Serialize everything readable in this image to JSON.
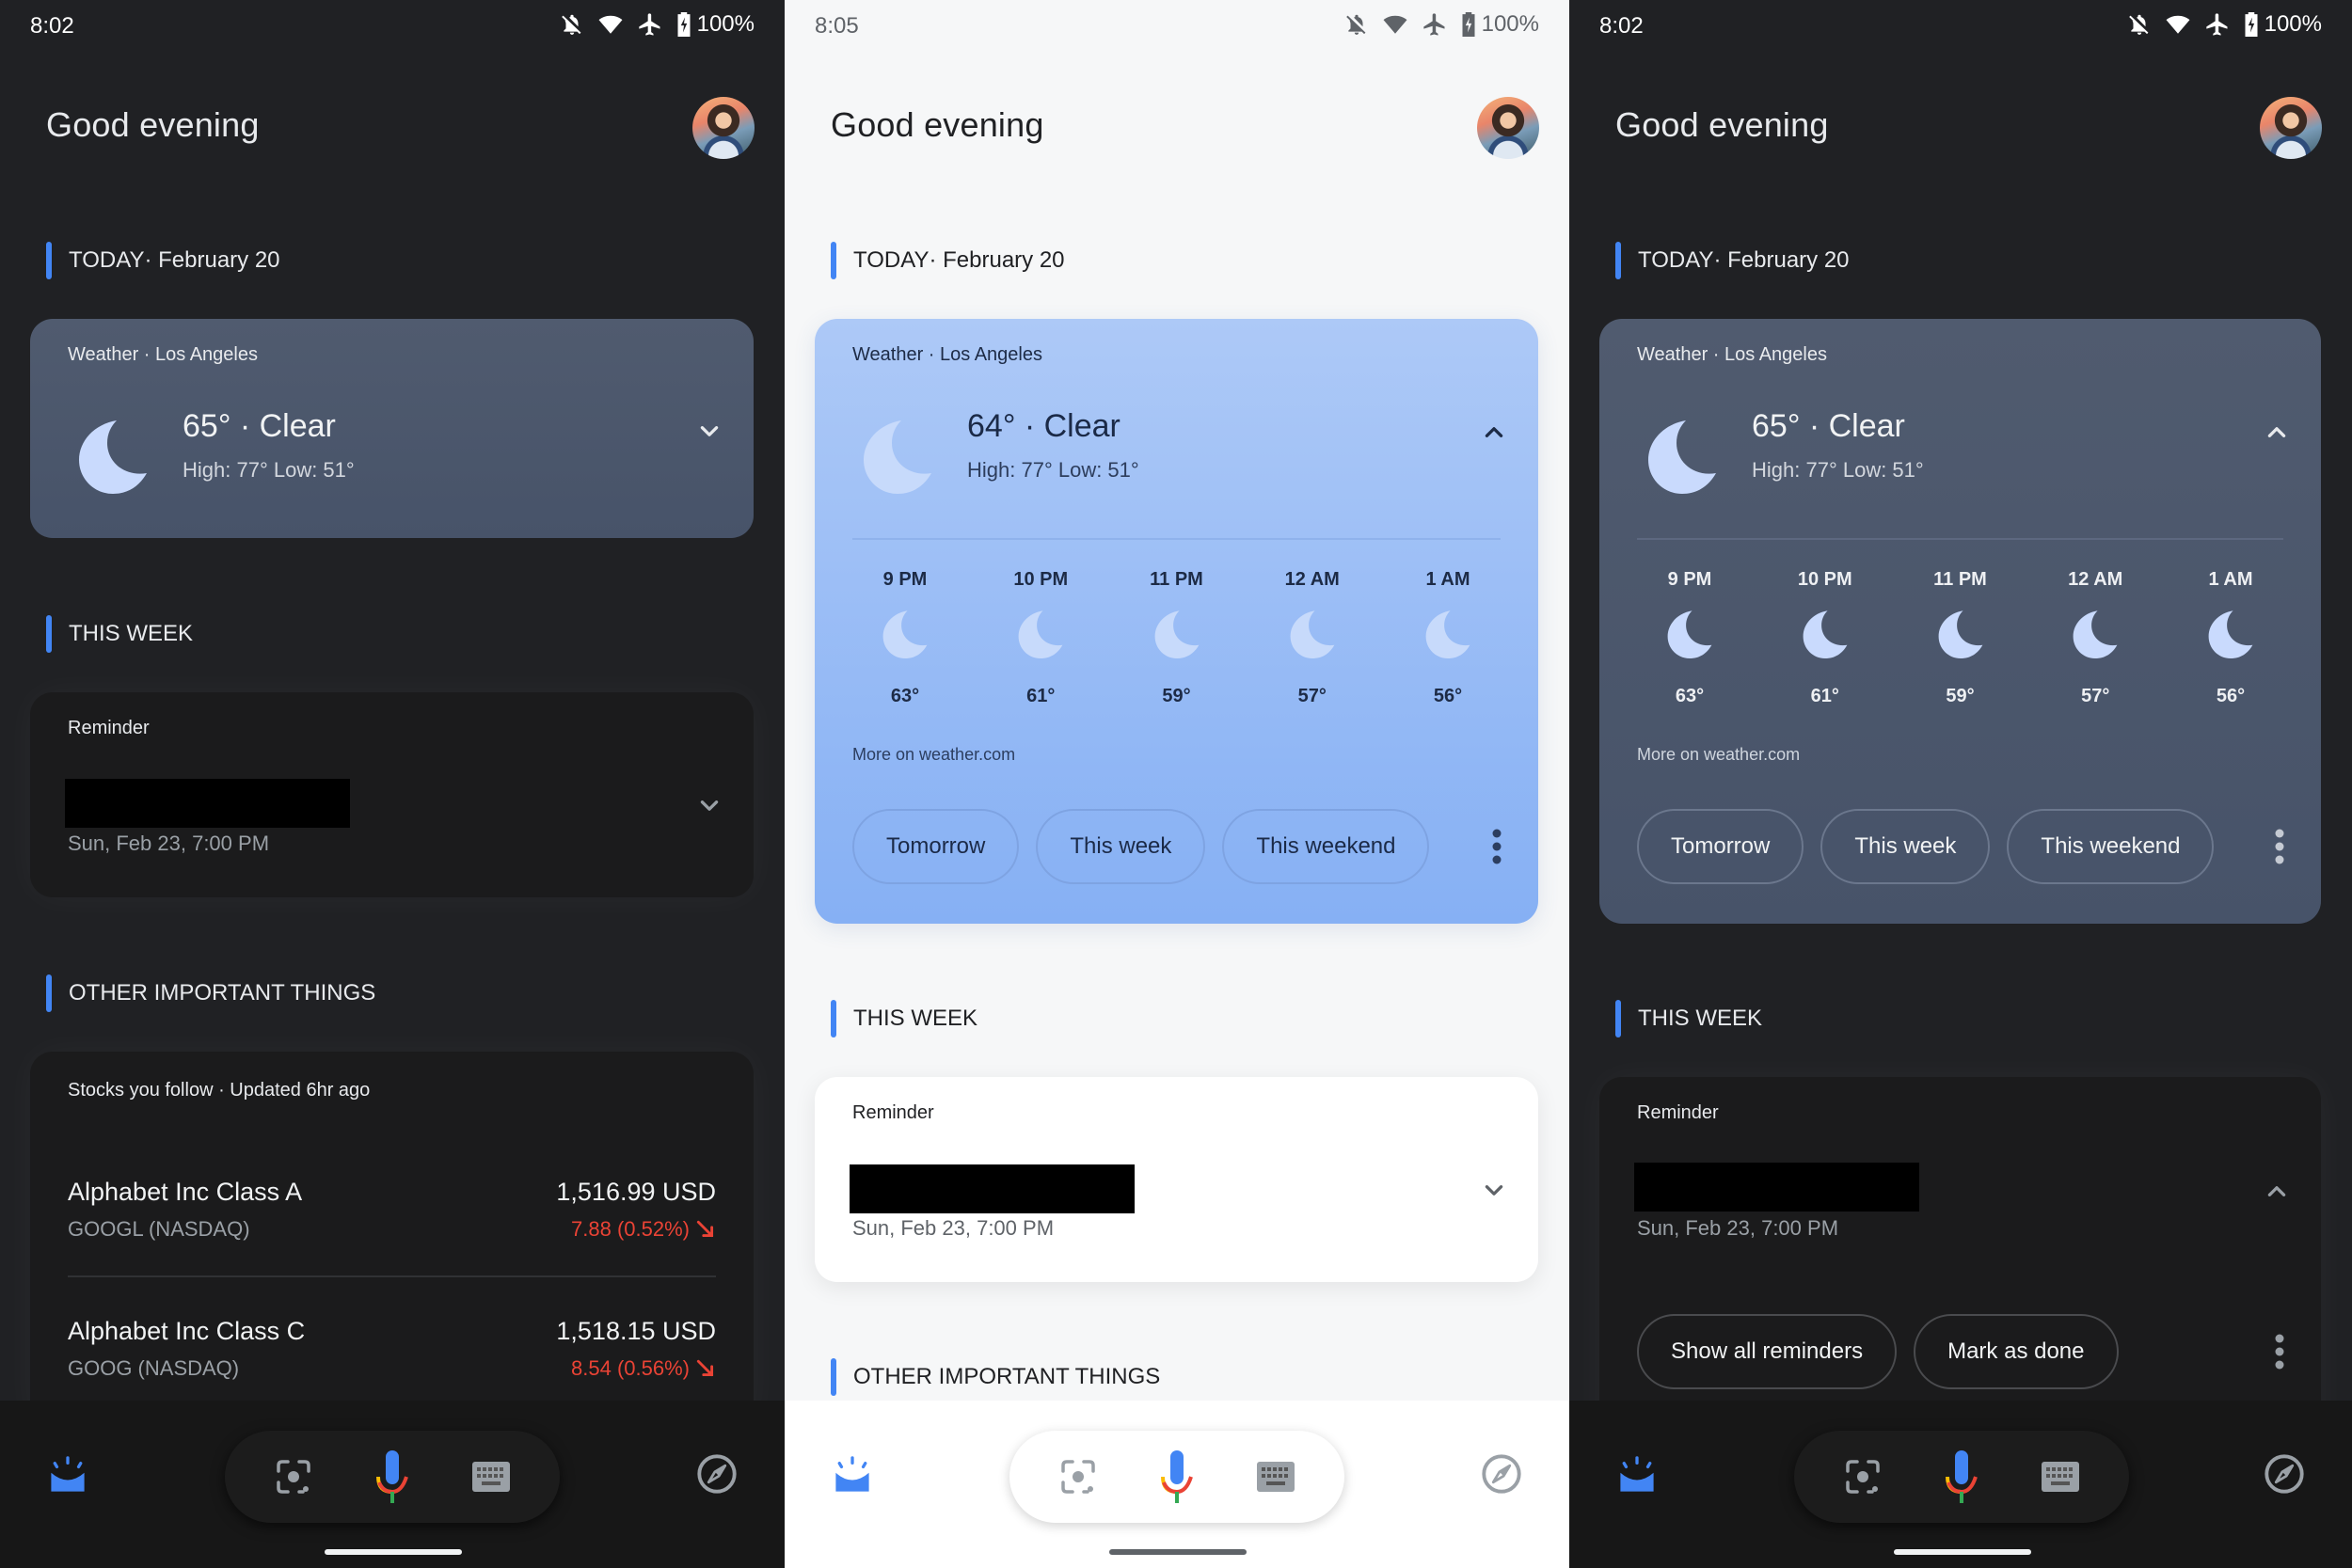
{
  "colors": {
    "accent_blue": "#4285f4",
    "dark_bg": "#202124",
    "light_bg": "#f6f7f8",
    "dark_weather_card": "#4d586c",
    "light_weather_card": "#9dbef6",
    "stock_down_red": "#ea4335",
    "mic_blue": "#4285f4",
    "mic_red": "#ea4335",
    "mic_yellow": "#fbbc04",
    "mic_green": "#34a853"
  },
  "panels": [
    {
      "theme": "dark",
      "status": {
        "time": "8:02",
        "battery": "100%",
        "icons": [
          "bell-off-icon",
          "wifi-icon",
          "airplane-icon",
          "battery-charging-icon"
        ]
      },
      "greeting": "Good evening",
      "sections": {
        "today": {
          "title": "TODAY",
          "subtitle": " · February 20"
        },
        "this_week": {
          "title": "THIS WEEK"
        },
        "other": {
          "title": "OTHER IMPORTANT THINGS"
        }
      },
      "weather": {
        "label": "Weather · Los Angeles",
        "temp_condition": "65° · Clear",
        "high_low": "High: 77° Low: 51°",
        "expanded": false
      },
      "reminder": {
        "label": "Reminder",
        "date": "Sun, Feb 23, 7:00 PM",
        "expanded": false
      },
      "stocks": {
        "label": "Stocks you follow · Updated 6hr ago",
        "items": [
          {
            "name": "Alphabet Inc Class A",
            "ticker": "GOOGL (NASDAQ)",
            "price": "1,516.99 USD",
            "change": "7.88 (0.52%)",
            "direction": "down"
          },
          {
            "name": "Alphabet Inc Class C",
            "ticker": "GOOG (NASDAQ)",
            "price": "1,518.15 USD",
            "change": "8.54 (0.56%)",
            "direction": "down"
          }
        ]
      },
      "bottom_nav": {
        "left": "updates-icon",
        "center": [
          "lens-icon",
          "mic-icon",
          "keyboard-icon"
        ],
        "right": "explore-compass-icon"
      }
    },
    {
      "theme": "light",
      "status": {
        "time": "8:05",
        "battery": "100%",
        "icons": [
          "bell-off-icon",
          "wifi-icon",
          "airplane-icon",
          "battery-charging-icon"
        ]
      },
      "greeting": "Good evening",
      "sections": {
        "today": {
          "title": "TODAY",
          "subtitle": " · February 20"
        },
        "this_week": {
          "title": "THIS WEEK"
        },
        "other": {
          "title": "OTHER IMPORTANT THINGS"
        }
      },
      "weather": {
        "label": "Weather · Los Angeles",
        "temp_condition": "64° · Clear",
        "high_low": "High: 77° Low: 51°",
        "expanded": true,
        "hourly": [
          {
            "time": "9 PM",
            "temp": "63°"
          },
          {
            "time": "10 PM",
            "temp": "61°"
          },
          {
            "time": "11 PM",
            "temp": "59°"
          },
          {
            "time": "12 AM",
            "temp": "57°"
          },
          {
            "time": "1 AM",
            "temp": "56°"
          }
        ],
        "more_link": "More on weather.com",
        "chips": [
          "Tomorrow",
          "This week",
          "This weekend"
        ]
      },
      "reminder": {
        "label": "Reminder",
        "date": "Sun, Feb 23, 7:00 PM",
        "expanded": false
      },
      "bottom_nav": {
        "left": "updates-icon",
        "center": [
          "lens-icon",
          "mic-icon",
          "keyboard-icon"
        ],
        "right": "explore-compass-icon"
      }
    },
    {
      "theme": "dark",
      "status": {
        "time": "8:02",
        "battery": "100%",
        "icons": [
          "bell-off-icon",
          "wifi-icon",
          "airplane-icon",
          "battery-charging-icon"
        ]
      },
      "greeting": "Good evening",
      "sections": {
        "today": {
          "title": "TODAY",
          "subtitle": " · February 20"
        },
        "this_week": {
          "title": "THIS WEEK"
        }
      },
      "weather": {
        "label": "Weather · Los Angeles",
        "temp_condition": "65° · Clear",
        "high_low": "High: 77° Low: 51°",
        "expanded": true,
        "hourly": [
          {
            "time": "9 PM",
            "temp": "63°"
          },
          {
            "time": "10 PM",
            "temp": "61°"
          },
          {
            "time": "11 PM",
            "temp": "59°"
          },
          {
            "time": "12 AM",
            "temp": "57°"
          },
          {
            "time": "1 AM",
            "temp": "56°"
          }
        ],
        "more_link": "More on weather.com",
        "chips": [
          "Tomorrow",
          "This week",
          "This weekend"
        ]
      },
      "reminder": {
        "label": "Reminder",
        "date": "Sun, Feb 23, 7:00 PM",
        "expanded": true,
        "chips": [
          "Show all reminders",
          "Mark as done"
        ]
      },
      "bottom_nav": {
        "left": "updates-icon",
        "center": [
          "lens-icon",
          "mic-icon",
          "keyboard-icon"
        ],
        "right": "explore-compass-icon"
      }
    }
  ]
}
